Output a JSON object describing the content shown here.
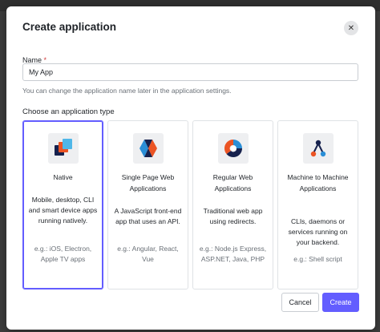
{
  "dialog": {
    "title": "Create application",
    "close_glyph": "✕"
  },
  "name_field": {
    "label": "Name",
    "required_mark": "*",
    "value": "My App",
    "help": "You can change the application name later in the application settings."
  },
  "type_section": {
    "label": "Choose an application type",
    "selected": "Native",
    "cards": [
      {
        "title": "Native",
        "icon": "native-app-icon",
        "description": "Mobile, desktop, CLI and smart device apps running natively.",
        "examples": "e.g.: iOS, Electron, Apple TV apps"
      },
      {
        "title": "Single Page Web Applications",
        "icon": "spa-icon",
        "description": "A JavaScript front-end app that uses an API.",
        "examples": "e.g.: Angular, React, Vue"
      },
      {
        "title": "Regular Web Applications",
        "icon": "regular-web-app-icon",
        "description": "Traditional web app using redirects.",
        "examples": "e.g.: Node.js Express, ASP.NET, Java, PHP"
      },
      {
        "title": "Machine to Machine Applications",
        "icon": "machine-to-machine-icon",
        "description": "CLIs, daemons or services running on your backend.",
        "examples": "e.g.: Shell script"
      }
    ]
  },
  "actions": {
    "cancel_label": "Cancel",
    "create_label": "Create"
  },
  "colors": {
    "accent": "#635dff",
    "orange": "#eb5424",
    "navy": "#16214d",
    "blue": "#2a8ed6"
  }
}
